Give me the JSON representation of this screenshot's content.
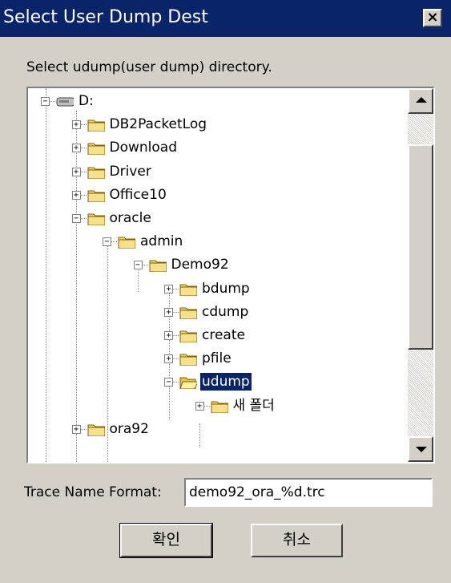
{
  "window": {
    "title": "Select User Dump Dest",
    "close_glyph": "×"
  },
  "prompt": "Select udump(user dump) directory.",
  "tree": {
    "nodes": [
      {
        "label": "D:",
        "icon": "drive-icon",
        "expander": "−"
      },
      {
        "label": "DB2PacketLog",
        "icon": "folder-icon",
        "expander": "+"
      },
      {
        "label": "Download",
        "icon": "folder-icon",
        "expander": "+"
      },
      {
        "label": "Driver",
        "icon": "folder-icon",
        "expander": "+"
      },
      {
        "label": "Office10",
        "icon": "folder-icon",
        "expander": "+"
      },
      {
        "label": "oracle",
        "icon": "folder-icon",
        "expander": "−"
      },
      {
        "label": "admin",
        "icon": "folder-icon",
        "expander": "−"
      },
      {
        "label": "Demo92",
        "icon": "folder-icon",
        "expander": "−"
      },
      {
        "label": "bdump",
        "icon": "folder-icon",
        "expander": "+"
      },
      {
        "label": "cdump",
        "icon": "folder-icon",
        "expander": "+"
      },
      {
        "label": "create",
        "icon": "folder-icon",
        "expander": "+"
      },
      {
        "label": "pfile",
        "icon": "folder-icon",
        "expander": "+"
      },
      {
        "label": "udump",
        "icon": "open-folder-icon",
        "expander": "−",
        "selected": true
      },
      {
        "label": "새 폴더",
        "icon": "folder-icon",
        "expander": "+"
      },
      {
        "label": "ora92",
        "icon": "folder-icon",
        "expander": "+"
      }
    ],
    "scrollbar": {
      "up_icon": "scroll-up-arrow-icon",
      "down_icon": "scroll-down-arrow-icon"
    }
  },
  "format": {
    "label": "Trace Name Format:",
    "value": "demo92_ora_%d.trc"
  },
  "buttons": {
    "ok": "확인",
    "cancel": "취소"
  },
  "colors": {
    "titlebar": "#0a246a",
    "face": "#d4d0c8",
    "folder": "#f5d76e",
    "selection": "#0a246a"
  }
}
